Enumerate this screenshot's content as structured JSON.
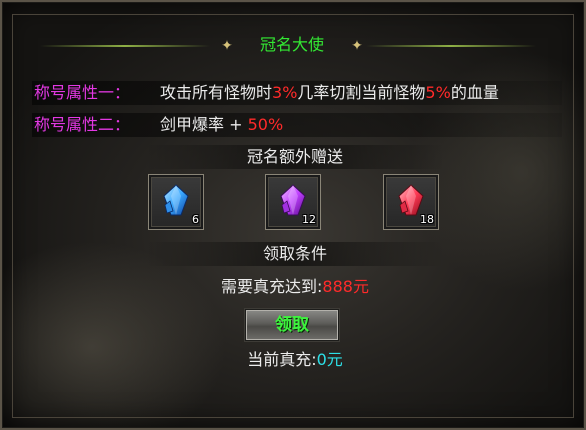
{
  "title": "冠名大使",
  "attributes": [
    {
      "label": "称号属性一：",
      "parts": [
        "攻击所有怪物时",
        "3%",
        "几率切割当前怪物",
        "5%",
        "的血量"
      ]
    },
    {
      "label": "称号属性二：",
      "parts": [
        "剑甲爆率 + ",
        "50%"
      ]
    }
  ],
  "bonus": {
    "title": "冠名额外赠送",
    "items": [
      {
        "icon": "blue-gem-icon",
        "color": "#3aa8ff",
        "count": "6"
      },
      {
        "icon": "purple-gem-icon",
        "color": "#c040ff",
        "count": "12"
      },
      {
        "icon": "red-gem-icon",
        "color": "#ff3a55",
        "count": "18"
      }
    ]
  },
  "condition": {
    "title": "领取条件",
    "label": "需要真充达到:",
    "value": "888元"
  },
  "claim_button": "领取",
  "current": {
    "label": "当前真充:",
    "value": "0元"
  },
  "colors": {
    "title": "#33e833",
    "label": "#e338e3",
    "highlight": "#ff2a2a",
    "current_value": "#2de0e8"
  }
}
